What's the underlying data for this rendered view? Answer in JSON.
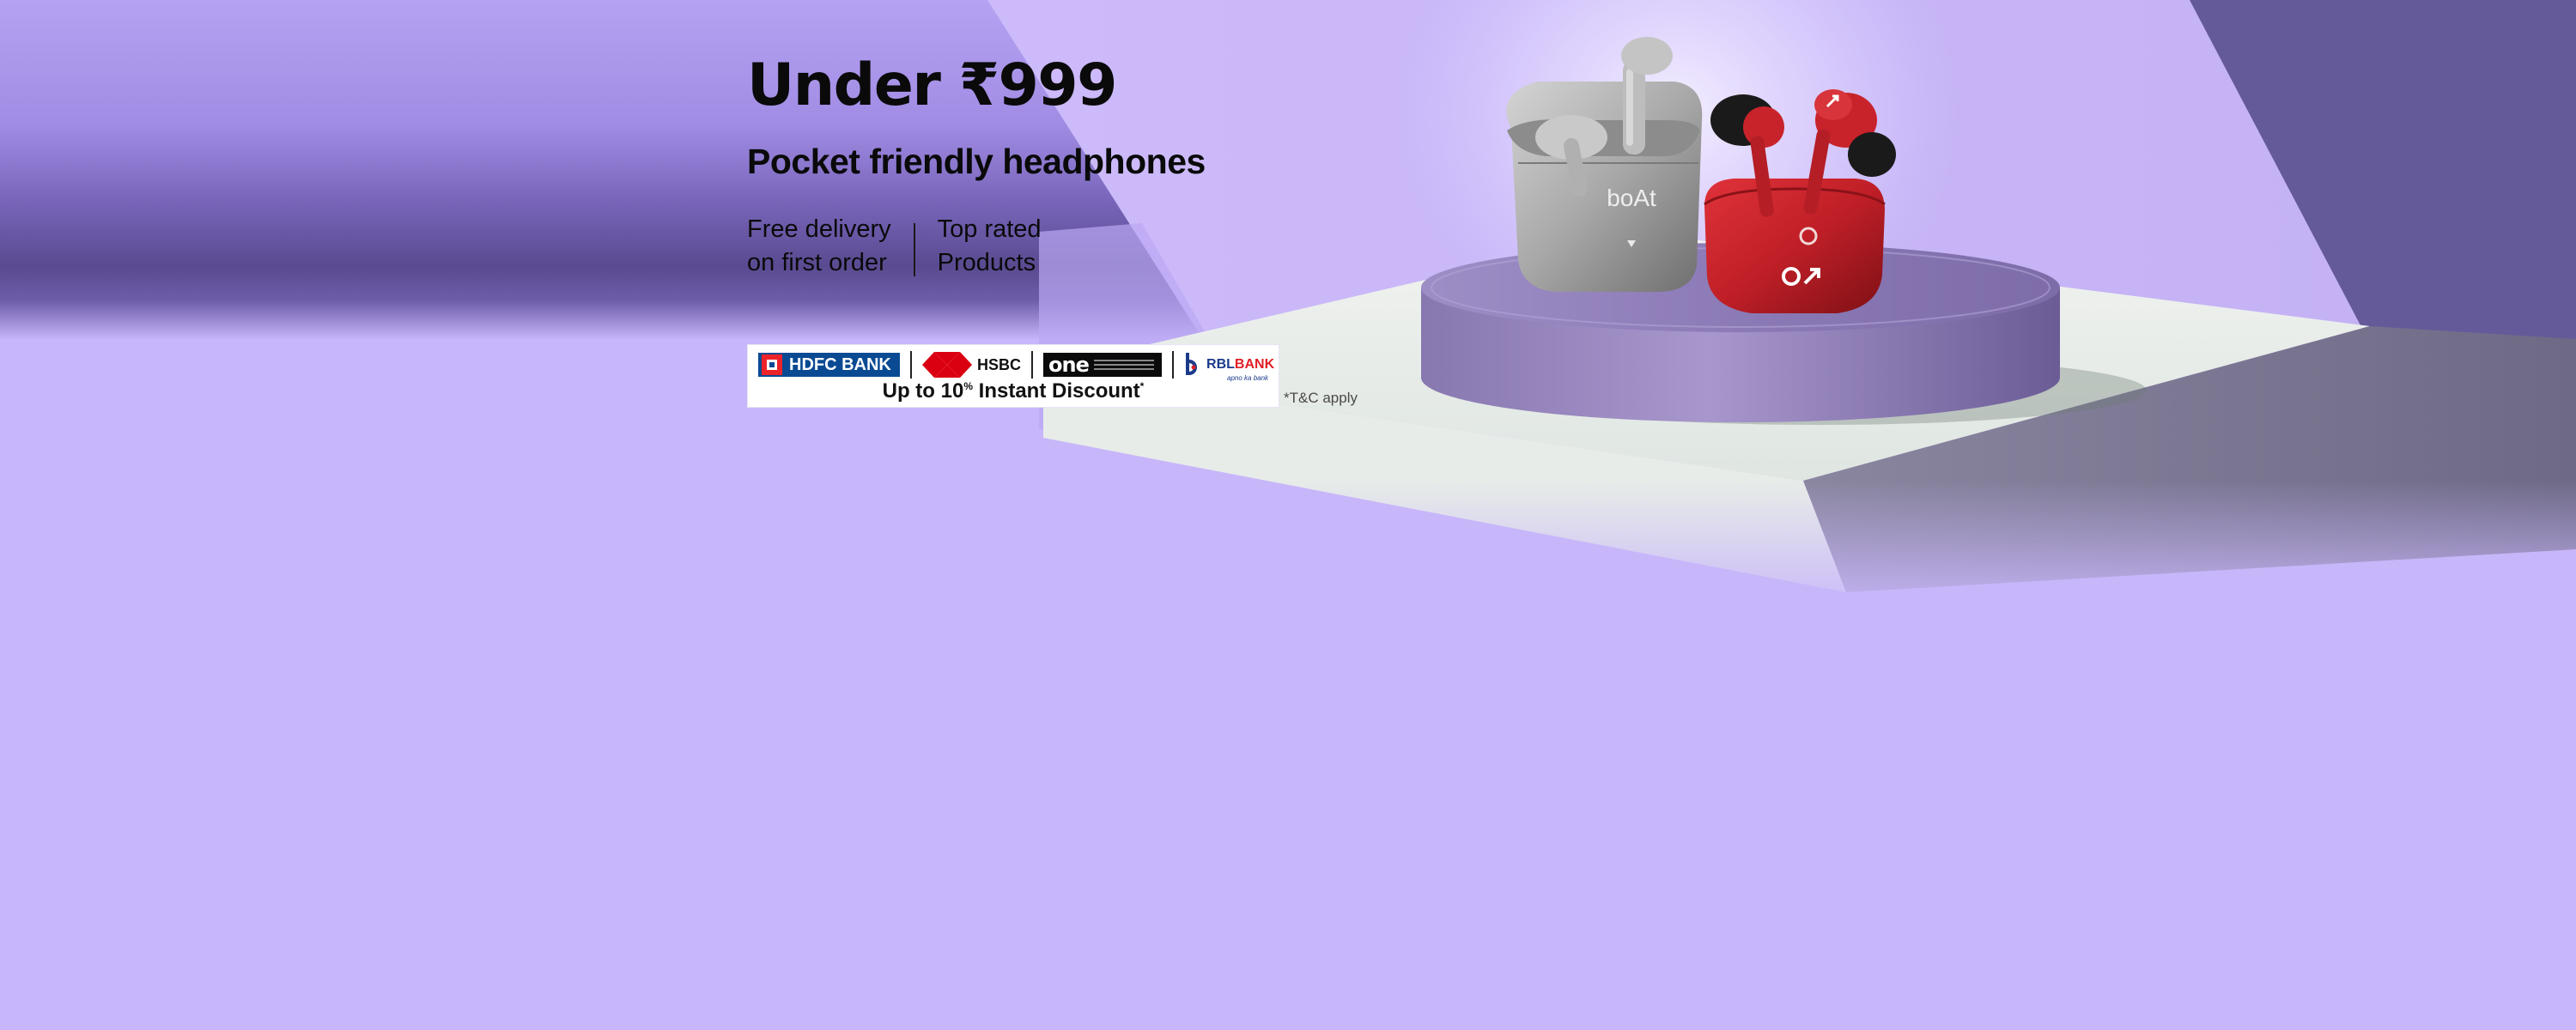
{
  "banner": {
    "headline": "Under ₹999",
    "subhead": "Pocket friendly headphones",
    "features": [
      {
        "line1": "Free delivery",
        "line2": "on first order"
      },
      {
        "line1": "Top rated",
        "line2": "Products"
      }
    ]
  },
  "offer": {
    "banks": [
      {
        "name": "HDFC BANK",
        "icon": "hdfc-logo"
      },
      {
        "name": "HSBC",
        "icon": "hsbc-logo"
      },
      {
        "name": "one",
        "icon": "onecard-logo"
      },
      {
        "name": "RBL",
        "name_accent": "BANK",
        "tagline": "apno ka bank",
        "icon": "rbl-logo"
      }
    ],
    "discount_text": "Up to 10",
    "discount_unit": "%",
    "discount_suffix": " Instant Discount",
    "discount_mark": "*",
    "terms": "*T&C apply"
  },
  "product": {
    "brand_mark": "boAt",
    "image": "earbuds-on-pedestal"
  },
  "colors": {
    "background": "#c8b6fa",
    "band_dark": "#5b4b91",
    "pedestal": "#8d7cb4",
    "case_red": "#c62026",
    "case_grey": "#9a9a9a",
    "hdfc_blue": "#0a4a93",
    "hsbc_red": "#db0011"
  }
}
